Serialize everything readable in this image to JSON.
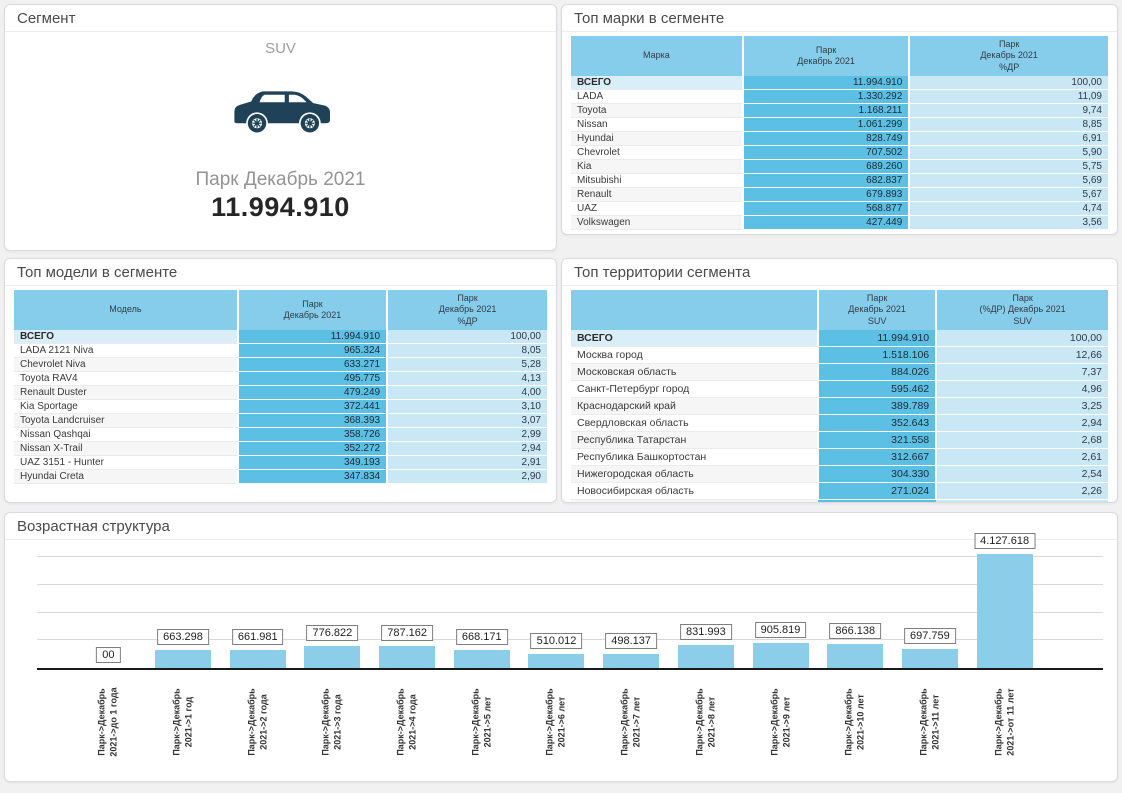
{
  "colors": {
    "table_header": "#85CDEB",
    "table_value_cell": "#5CBFE4",
    "table_percent_cell": "#C9E7F5",
    "table_total_label": "#D9EEF9",
    "bar": "#8CCEE9",
    "car_icon": "#1F4258"
  },
  "panels": {
    "segment": {
      "title": "Сегмент",
      "segment_name": "SUV",
      "icon": "suv-car-icon",
      "metric_label": "Парк Декабрь 2021",
      "metric_value": "11.994.910"
    },
    "brands": {
      "title": "Топ марки в сегменте",
      "columns": [
        "Марка",
        "Парк\nДекабрь 2021",
        "Парк\nДекабрь 2021\n%ДР"
      ],
      "rows": [
        [
          "ВСЕГО",
          "11.994.910",
          "100,00"
        ],
        [
          "LADA",
          "1.330.292",
          "11,09"
        ],
        [
          "Toyota",
          "1.168.211",
          "9,74"
        ],
        [
          "Nissan",
          "1.061.299",
          "8,85"
        ],
        [
          "Hyundai",
          "828.749",
          "6,91"
        ],
        [
          "Chevrolet",
          "707.502",
          "5,90"
        ],
        [
          "Kia",
          "689.260",
          "5,75"
        ],
        [
          "Mitsubishi",
          "682.837",
          "5,69"
        ],
        [
          "Renault",
          "679.893",
          "5,67"
        ],
        [
          "UAZ",
          "568.877",
          "4,74"
        ],
        [
          "Volkswagen",
          "427.449",
          "3,56"
        ]
      ]
    },
    "models": {
      "title": "Топ модели в сегменте",
      "columns": [
        "Модель",
        "Парк\nДекабрь 2021",
        "Парк\nДекабрь 2021\n%ДР"
      ],
      "rows": [
        [
          "ВСЕГО",
          "11.994.910",
          "100,00"
        ],
        [
          "LADA 2121 Niva",
          "965.324",
          "8,05"
        ],
        [
          "Chevrolet Niva",
          "633.271",
          "5,28"
        ],
        [
          "Toyota RAV4",
          "495.775",
          "4,13"
        ],
        [
          "Renault Duster",
          "479.249",
          "4,00"
        ],
        [
          "Kia Sportage",
          "372.441",
          "3,10"
        ],
        [
          "Toyota Landcruiser",
          "368.393",
          "3,07"
        ],
        [
          "Nissan Qashqai",
          "358.726",
          "2,99"
        ],
        [
          "Nissan X-Trail",
          "352.272",
          "2,94"
        ],
        [
          "UAZ 3151 - Hunter",
          "349.193",
          "2,91"
        ],
        [
          "Hyundai Creta",
          "347.834",
          "2,90"
        ]
      ]
    },
    "territories": {
      "title": "Топ территории сегмента",
      "columns": [
        "",
        "Парк\nДекабрь 2021\nSUV",
        "Парк\n(%ДР) Декабрь 2021\nSUV"
      ],
      "rows": [
        [
          "ВСЕГО",
          "11.994.910",
          "100,00"
        ],
        [
          "Москва город",
          "1.518.106",
          "12,66"
        ],
        [
          "Московская область",
          "884.026",
          "7,37"
        ],
        [
          "Санкт-Петербург город",
          "595.462",
          "4,96"
        ],
        [
          "Краснодарский край",
          "389.789",
          "3,25"
        ],
        [
          "Свердловская область",
          "352.643",
          "2,94"
        ],
        [
          "Республика Татарстан",
          "321.558",
          "2,68"
        ],
        [
          "Республика Башкортостан",
          "312.667",
          "2,61"
        ],
        [
          "Нижегородская область",
          "304.330",
          "2,54"
        ],
        [
          "Новосибирская область",
          "271.024",
          "2,26"
        ]
      ],
      "clipped_next_row": true
    },
    "age": {
      "title": "Возрастная структура"
    }
  },
  "chart_data": {
    "type": "bar",
    "title": "Возрастная структура",
    "categories": [
      "до 1 года",
      "1 год",
      "2 года",
      "3 года",
      "4 года",
      "5 лет",
      "6 лет",
      "7 лет",
      "8 лет",
      "9 лет",
      "10 лет",
      "11 лет",
      "от 11 лет"
    ],
    "x_tick_labels": [
      "Парк->Декабрь\n2021->до 1 года",
      "Парк->Декабрь\n2021->1 год",
      "Парк->Декабрь\n2021->2 года",
      "Парк->Декабрь\n2021->3 года",
      "Парк->Декабрь\n2021->4 года",
      "Парк->Декабрь\n2021->5 лет",
      "Парк->Декабрь\n2021->6 лет",
      "Парк->Декабрь\n2021->7 лет",
      "Парк->Декабрь\n2021->8 лет",
      "Парк->Декабрь\n2021->9 лет",
      "Парк->Декабрь\n2021->10 лет",
      "Парк->Декабрь\n2021->11 лет",
      "Парк->Декабрь\n2021->от 11 лет"
    ],
    "values": [
      0,
      663298,
      661981,
      776822,
      787162,
      668171,
      510012,
      498137,
      831993,
      905819,
      866138,
      697759,
      4127618
    ],
    "bar_labels": [
      "00",
      "663.298",
      "661.981",
      "776.822",
      "787.162",
      "668.171",
      "510.012",
      "498.137",
      "831.993",
      "905.819",
      "866.138",
      "697.759",
      "4.127.618"
    ],
    "ylim": [
      0,
      4500000
    ],
    "gridlines": [
      1000000,
      2000000,
      3000000,
      4000000
    ],
    "grid": true,
    "legend": false,
    "xlabel": "",
    "ylabel": ""
  }
}
